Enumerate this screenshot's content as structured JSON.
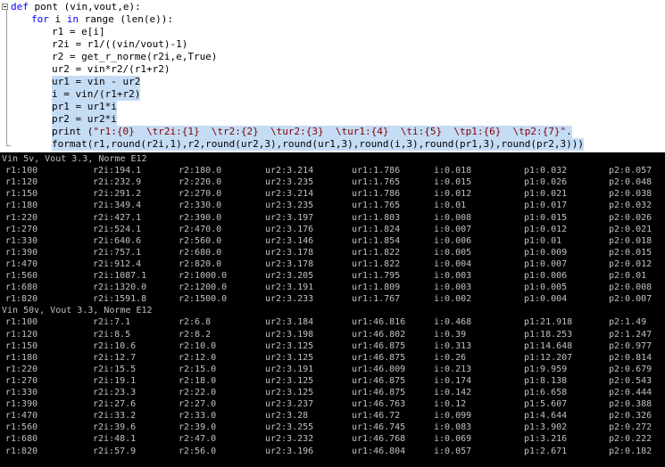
{
  "editor": {
    "lines": [
      {
        "indent": 0,
        "segments": [
          [
            "kw",
            "def"
          ],
          [
            "t",
            " pont (vin,vout,e):"
          ]
        ]
      },
      {
        "indent": 1,
        "segments": [
          [
            "kw",
            "for"
          ],
          [
            "t",
            " i "
          ],
          [
            "kw",
            "in"
          ],
          [
            "t",
            " range (len(e)):"
          ]
        ]
      },
      {
        "indent": 2,
        "segments": [
          [
            "t",
            "r1 = e[i]"
          ]
        ]
      },
      {
        "indent": 2,
        "segments": [
          [
            "t",
            "r2i = r1/((vin/vout)-1)"
          ]
        ]
      },
      {
        "indent": 2,
        "segments": [
          [
            "t",
            "r2 = get_r_norme(r2i,e,True)"
          ]
        ]
      },
      {
        "indent": 2,
        "segments": [
          [
            "t",
            "ur2 = vin*r2/(r1+r2)"
          ]
        ]
      },
      {
        "indent": 2,
        "selected": true,
        "segments": [
          [
            "t",
            "ur1 = vin - ur2"
          ]
        ]
      },
      {
        "indent": 2,
        "selected": true,
        "segments": [
          [
            "t",
            "i = vin/(r1+r2)"
          ]
        ]
      },
      {
        "indent": 2,
        "selected": true,
        "segments": [
          [
            "t",
            "pr1 = ur1*i"
          ]
        ]
      },
      {
        "indent": 2,
        "selected": true,
        "segments": [
          [
            "t",
            "pr2 = ur2*i"
          ]
        ]
      },
      {
        "indent": 2,
        "selected": true,
        "segments": [
          [
            "t",
            "print ("
          ],
          [
            "str",
            "\"r1:{0}  \\tr2i:{1}  \\tr2:{2}  \\tur2:{3}  \\tur1:{4}  \\ti:{5}  \\tp1:{6}  \\tp2:{7}\""
          ],
          [
            "t",
            "."
          ]
        ]
      },
      {
        "indent": 2,
        "selected": true,
        "segments": [
          [
            "t",
            "format(r1,round(r2i,1),r2,round(ur2,3),round(ur1,3),round(i,3),round(pr1,3),round(pr2,3)))"
          ]
        ]
      }
    ]
  },
  "console": {
    "sections": [
      {
        "header": "Vin 5v, Vout 3.3, Norme E12",
        "rows": [
          [
            "r1:100",
            "r2i:194.1",
            "r2:180.0",
            "ur2:3.214",
            "ur1:1.786",
            "i:0.018",
            "p1:0.032",
            "p2:0.057"
          ],
          [
            "r1:120",
            "r2i:232.9",
            "r2:220.0",
            "ur2:3.235",
            "ur1:1.765",
            "i:0.015",
            "p1:0.026",
            "p2:0.048"
          ],
          [
            "r1:150",
            "r2i:291.2",
            "r2:270.0",
            "ur2:3.214",
            "ur1:1.786",
            "i:0.012",
            "p1:0.021",
            "p2:0.038"
          ],
          [
            "r1:180",
            "r2i:349.4",
            "r2:330.0",
            "ur2:3.235",
            "ur1:1.765",
            "i:0.01",
            "p1:0.017",
            "p2:0.032"
          ],
          [
            "r1:220",
            "r2i:427.1",
            "r2:390.0",
            "ur2:3.197",
            "ur1:1.803",
            "i:0.008",
            "p1:0.015",
            "p2:0.026"
          ],
          [
            "r1:270",
            "r2i:524.1",
            "r2:470.0",
            "ur2:3.176",
            "ur1:1.824",
            "i:0.007",
            "p1:0.012",
            "p2:0.021"
          ],
          [
            "r1:330",
            "r2i:640.6",
            "r2:560.0",
            "ur2:3.146",
            "ur1:1.854",
            "i:0.006",
            "p1:0.01",
            "p2:0.018"
          ],
          [
            "r1:390",
            "r2i:757.1",
            "r2:680.0",
            "ur2:3.178",
            "ur1:1.822",
            "i:0.005",
            "p1:0.009",
            "p2:0.015"
          ],
          [
            "r1:470",
            "r2i:912.4",
            "r2:820.0",
            "ur2:3.178",
            "ur1:1.822",
            "i:0.004",
            "p1:0.007",
            "p2:0.012"
          ],
          [
            "r1:560",
            "r2i:1087.1",
            "r2:1000.0",
            "ur2:3.205",
            "ur1:1.795",
            "i:0.003",
            "p1:0.006",
            "p2:0.01"
          ],
          [
            "r1:680",
            "r2i:1320.0",
            "r2:1200.0",
            "ur2:3.191",
            "ur1:1.809",
            "i:0.003",
            "p1:0.005",
            "p2:0.008"
          ],
          [
            "r1:820",
            "r2i:1591.8",
            "r2:1500.0",
            "ur2:3.233",
            "ur1:1.767",
            "i:0.002",
            "p1:0.004",
            "p2:0.007"
          ]
        ]
      },
      {
        "header": "Vin 50v, Vout 3.3, Norme E12",
        "rows": [
          [
            "r1:100",
            "r2i:7.1",
            "r2:6.8",
            "ur2:3.184",
            "ur1:46.816",
            "i:0.468",
            "p1:21.918",
            "p2:1.49"
          ],
          [
            "r1:120",
            "r2i:8.5",
            "r2:8.2",
            "ur2:3.198",
            "ur1:46.802",
            "i:0.39",
            "p1:18.253",
            "p2:1.247"
          ],
          [
            "r1:150",
            "r2i:10.6",
            "r2:10.0",
            "ur2:3.125",
            "ur1:46.875",
            "i:0.313",
            "p1:14.648",
            "p2:0.977"
          ],
          [
            "r1:180",
            "r2i:12.7",
            "r2:12.0",
            "ur2:3.125",
            "ur1:46.875",
            "i:0.26",
            "p1:12.207",
            "p2:0.814"
          ],
          [
            "r1:220",
            "r2i:15.5",
            "r2:15.0",
            "ur2:3.191",
            "ur1:46.809",
            "i:0.213",
            "p1:9.959",
            "p2:0.679"
          ],
          [
            "r1:270",
            "r2i:19.1",
            "r2:18.0",
            "ur2:3.125",
            "ur1:46.875",
            "i:0.174",
            "p1:8.138",
            "p2:0.543"
          ],
          [
            "r1:330",
            "r2i:23.3",
            "r2:22.0",
            "ur2:3.125",
            "ur1:46.875",
            "i:0.142",
            "p1:6.658",
            "p2:0.444"
          ],
          [
            "r1:390",
            "r2i:27.6",
            "r2:27.0",
            "ur2:3.237",
            "ur1:46.763",
            "i:0.12",
            "p1:5.607",
            "p2:0.388"
          ],
          [
            "r1:470",
            "r2i:33.2",
            "r2:33.0",
            "ur2:3.28",
            "ur1:46.72",
            "i:0.099",
            "p1:4.644",
            "p2:0.326"
          ],
          [
            "r1:560",
            "r2i:39.6",
            "r2:39.0",
            "ur2:3.255",
            "ur1:46.745",
            "i:0.083",
            "p1:3.902",
            "p2:0.272"
          ],
          [
            "r1:680",
            "r2i:48.1",
            "r2:47.0",
            "ur2:3.232",
            "ur1:46.768",
            "i:0.069",
            "p1:3.216",
            "p2:0.222"
          ],
          [
            "r1:820",
            "r2i:57.9",
            "r2:56.0",
            "ur2:3.196",
            "ur1:46.804",
            "i:0.057",
            "p1:2.671",
            "p2:0.182"
          ]
        ]
      }
    ]
  },
  "colors": {
    "selection": "#c5dcf5",
    "keyword": "#0000ff",
    "string": "#800000",
    "console_bg": "#000000",
    "console_text": "#c0c0c0"
  }
}
